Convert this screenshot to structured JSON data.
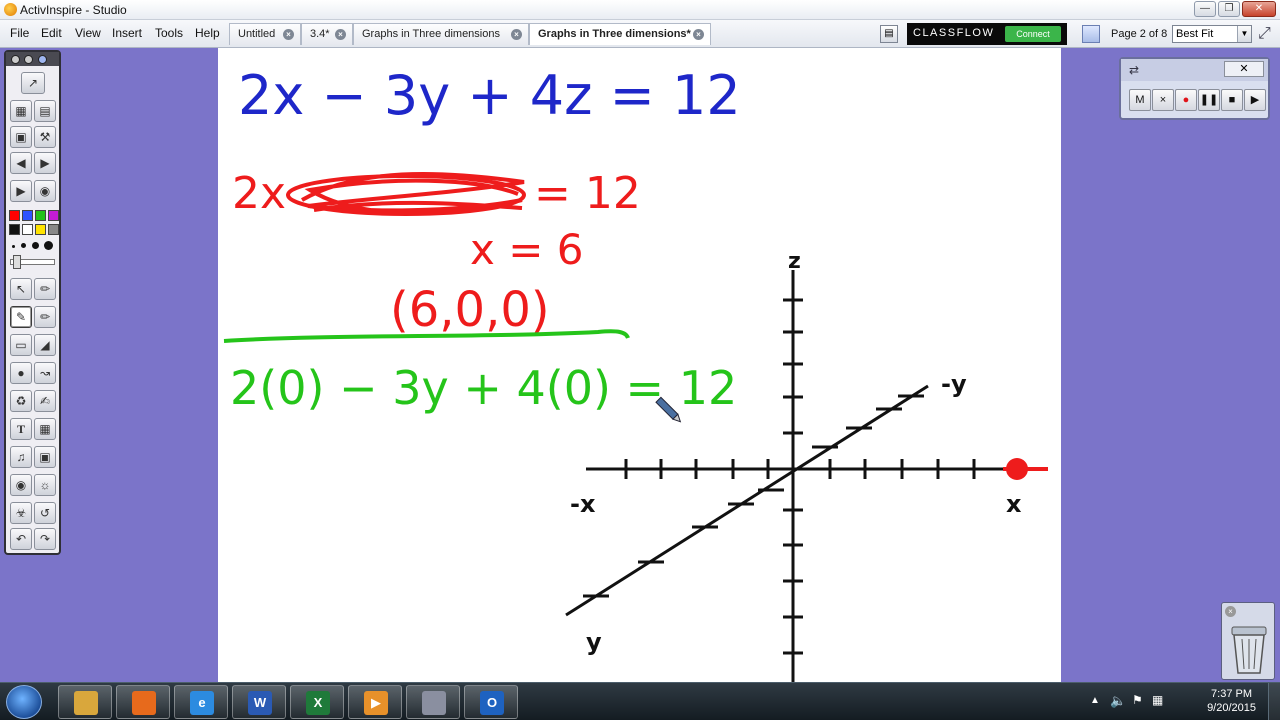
{
  "window": {
    "title": "ActivInspire - Studio"
  },
  "menu": [
    "File",
    "Edit",
    "View",
    "Insert",
    "Tools",
    "Help"
  ],
  "tabs": [
    {
      "label": "Untitled"
    },
    {
      "label": "3.4*"
    },
    {
      "label": "Graphs in Three dimensions"
    },
    {
      "label": "Graphs in Three dimensions*"
    }
  ],
  "classflow": {
    "logo": "CLASSFLOW",
    "connect": "Connect"
  },
  "page_indicator": "Page 2 of 8",
  "zoom": {
    "value": "Best Fit"
  },
  "toolbox": {
    "colors": [
      "#ff0000",
      "#2f53ff",
      "#24c21a",
      "#c31cd6",
      "#111111",
      "#ffffff",
      "#ffe300",
      "#888888"
    ]
  },
  "canvas": {
    "equation_main": "2x − 3y + 4z = 12",
    "equation_main_color": "#1e27c9",
    "red_line1_prefix": "2x",
    "red_line1_suffix": "= 12",
    "red_x_value": "x = 6",
    "red_point": "(6,0,0)",
    "red_color": "#ee1c1c",
    "green_equation": "2(0) − 3y + 4(0) = 12",
    "green_color": "#25c41a",
    "axis_labels": {
      "z": "z",
      "neg_y": "-y",
      "neg_x": "-x",
      "x": "x",
      "y": "y"
    }
  },
  "recorder": {
    "buttons": [
      "M",
      "×",
      "●",
      "❚❚",
      "■",
      "▶"
    ]
  },
  "taskbar": {
    "apps": [
      {
        "name": "explorer",
        "label": "",
        "color": "#d9a73c"
      },
      {
        "name": "firefox",
        "label": "",
        "color": "#e76a1c"
      },
      {
        "name": "ie",
        "label": "e",
        "color": "#2c8be0"
      },
      {
        "name": "word",
        "label": "W",
        "color": "#2a5ab4"
      },
      {
        "name": "excel",
        "label": "X",
        "color": "#1f7a3a"
      },
      {
        "name": "media",
        "label": "▶",
        "color": "#e8912a"
      },
      {
        "name": "activinspire",
        "label": "",
        "color": "#8a8fa0"
      },
      {
        "name": "outlook",
        "label": "O",
        "color": "#1e62c0"
      }
    ],
    "time": "7:37 PM",
    "date": "9/20/2015"
  }
}
